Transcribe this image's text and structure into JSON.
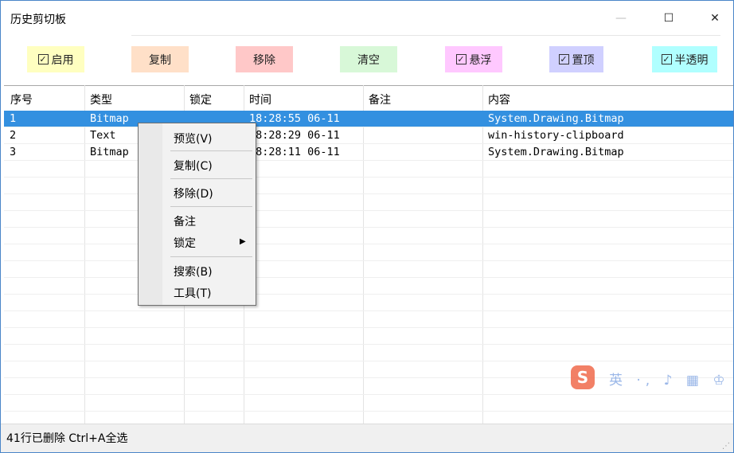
{
  "window": {
    "title": "历史剪切板",
    "controls": {
      "minimize": "—",
      "maximize": "☐",
      "close": "✕"
    }
  },
  "toolbar": {
    "items": [
      {
        "label": "启用",
        "checkbox": true,
        "checked": true,
        "color": "#ffffc0"
      },
      {
        "label": "复制",
        "checkbox": false,
        "color": "#ffe0c8"
      },
      {
        "label": "移除",
        "checkbox": false,
        "color": "#ffc8c8"
      },
      {
        "label": "清空",
        "checkbox": false,
        "color": "#d8f8d8"
      },
      {
        "label": "悬浮",
        "checkbox": true,
        "checked": true,
        "color": "#ffc8ff"
      },
      {
        "label": "置顶",
        "checkbox": true,
        "checked": true,
        "color": "#d0d0ff"
      },
      {
        "label": "半透明",
        "checkbox": true,
        "checked": true,
        "color": "#b0ffff"
      }
    ]
  },
  "table": {
    "columns": [
      "序号",
      "类型",
      "锁定",
      "时间",
      "备注",
      "内容"
    ],
    "rows": [
      {
        "index": "1",
        "type": "Bitmap",
        "locked": "",
        "time": "18:28:55 06-11",
        "note": "",
        "content": "System.Drawing.Bitmap",
        "selected": true
      },
      {
        "index": "2",
        "type": "Text",
        "locked": "",
        "time": "18:28:29 06-11",
        "note": "",
        "content": "win-history-clipboard",
        "selected": false
      },
      {
        "index": "3",
        "type": "Bitmap",
        "locked": "",
        "time": "18:28:11 06-11",
        "note": "",
        "content": "System.Drawing.Bitmap",
        "selected": false
      }
    ],
    "selected_color": "#3390e0"
  },
  "context_menu": {
    "items": [
      {
        "label": "预览(V)"
      },
      {
        "label": "复制(C)"
      },
      {
        "label": "移除(D)"
      },
      {
        "label": "备注"
      },
      {
        "label": "锁定",
        "submenu": true
      },
      {
        "label": "搜索(B)"
      },
      {
        "label": "工具(T)"
      }
    ]
  },
  "status": {
    "text": "41行已删除  Ctrl+A全选"
  },
  "ime": {
    "logo": "S",
    "text": "英 ·, ♪ ▦ ♔ ⋮"
  }
}
